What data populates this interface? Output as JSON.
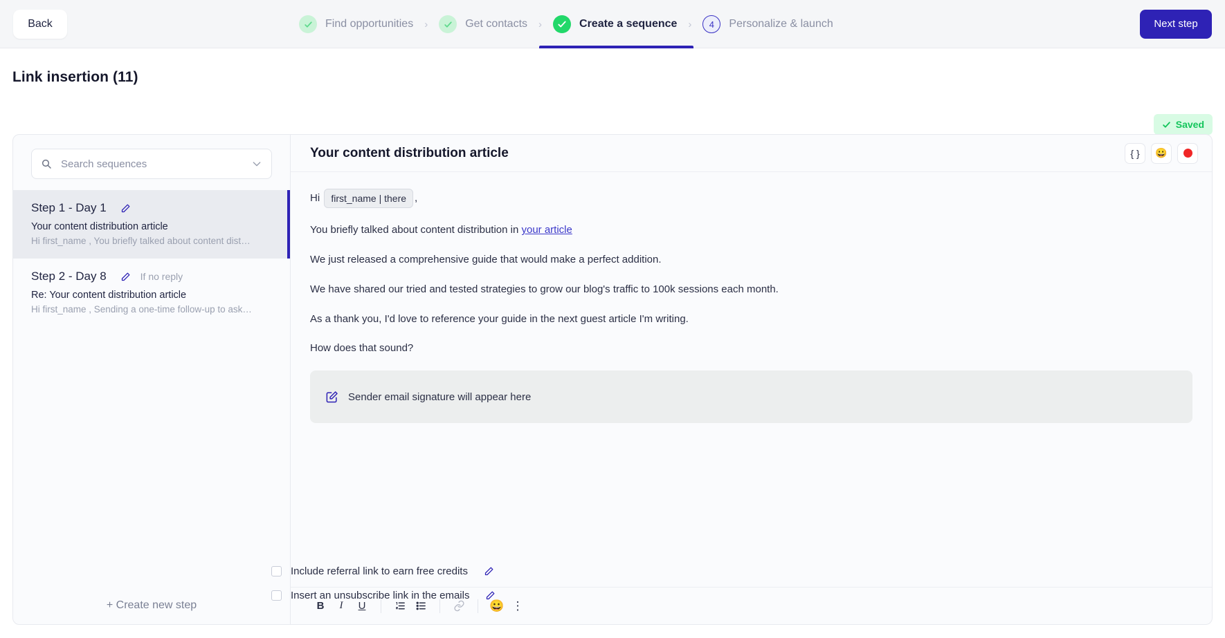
{
  "topbar": {
    "back_label": "Back",
    "next_label": "Next step",
    "steps": [
      {
        "label": "Find opportunities",
        "state": "done",
        "marker": "check"
      },
      {
        "label": "Get contacts",
        "state": "done",
        "marker": "check"
      },
      {
        "label": "Create a sequence",
        "state": "active",
        "marker": "check"
      },
      {
        "label": "Personalize & launch",
        "state": "pending",
        "marker": "4"
      }
    ],
    "separator": "›"
  },
  "page": {
    "title": "Link insertion (11)",
    "saved_label": "Saved",
    "saved_check": "✓"
  },
  "sidebar": {
    "search": {
      "placeholder": "Search sequences",
      "value": "",
      "icon": "search-icon",
      "chevron": "chevron-down-icon"
    },
    "steps": [
      {
        "name": "Step 1 - Day 1",
        "condition": "",
        "subject": "Your content distribution article",
        "preview": "Hi first_name , You briefly talked about content distribution i...",
        "selected": true
      },
      {
        "name": "Step 2 - Day 8",
        "condition": "If no reply",
        "subject": "Re: Your content distribution article",
        "preview": "Hi first_name , Sending a one-time follow-up to ask if you're ...",
        "selected": false
      }
    ],
    "create_step_label": "+  Create new step"
  },
  "editor": {
    "subject": "Your content distribution article",
    "header_tools": [
      {
        "name": "variables-icon",
        "glyph": "{ }"
      },
      {
        "name": "emoji-icon",
        "glyph": "😀"
      },
      {
        "name": "record-icon",
        "glyph": ""
      }
    ],
    "body": {
      "greeting_prefix": "Hi",
      "greeting_token": "first_name | there",
      "greeting_suffix": ",",
      "line2_before": "You briefly talked about content distribution in ",
      "line2_link": "your article",
      "line3": "We just released a comprehensive guide that would make a perfect addition.",
      "line4": "We have shared our tried and tested strategies to grow our blog's traffic to 100k sessions each month.",
      "line5": "As a thank you, I'd love to reference your guide in the next guest article I'm writing.",
      "line6": "How does that sound?",
      "signature_placeholder": "Sender email signature will appear here"
    },
    "toolbar": [
      {
        "name": "bold-button",
        "glyph": "B"
      },
      {
        "name": "italic-button",
        "glyph": "I"
      },
      {
        "name": "underline-button",
        "glyph": "U"
      },
      {
        "name": "ordered-list-button",
        "glyph": "ol"
      },
      {
        "name": "bullet-list-button",
        "glyph": "ul"
      },
      {
        "name": "link-button",
        "glyph": "link"
      },
      {
        "name": "emoji-button",
        "glyph": "😀"
      },
      {
        "name": "more-options-button",
        "glyph": "⋮"
      }
    ]
  },
  "footer": {
    "options": [
      {
        "label": "Include referral link to earn free credits",
        "checked": false
      },
      {
        "label": "Insert an unsubscribe link in the emails",
        "checked": false
      }
    ]
  },
  "colors": {
    "primary": "#2e22b5",
    "success": "#22d86a",
    "saved_text": "#13c55b",
    "record": "#f02626",
    "link": "#3b38c9"
  }
}
